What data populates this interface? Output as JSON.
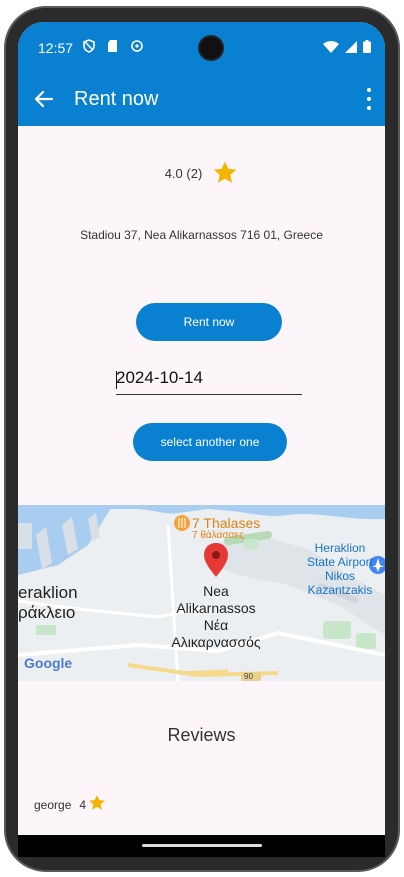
{
  "status_bar": {
    "time": "12:57"
  },
  "app_bar": {
    "title": "Rent now"
  },
  "rating": {
    "score": "4.0 (2)",
    "star_color": "#f5b400"
  },
  "address": "Stadiou 37, Nea Alikarnassos 716 01, Greece",
  "rent_button": {
    "label": "Rent now"
  },
  "date_input": {
    "value": "2024-10-14"
  },
  "select_button": {
    "label": "select another one"
  },
  "map": {
    "poi_name": "7 Thalases",
    "poi_name_greek": "7 θάλασσες",
    "airport_label": [
      "Heraklion",
      "State Airport",
      "Nikos",
      "Kazantzakis"
    ],
    "city_label": [
      "eraklion",
      "ράκλειο"
    ],
    "place_label": [
      "Nea",
      "Alikarnassos",
      "Νέα",
      "Αλικαρνασσός"
    ],
    "road_number": "90",
    "attribution": "Google"
  },
  "reviews": {
    "title": "Reviews",
    "items": [
      {
        "user": "george",
        "rating": "4"
      }
    ]
  },
  "colors": {
    "primary": "#0a81d0",
    "background": "#fcf6fb"
  }
}
